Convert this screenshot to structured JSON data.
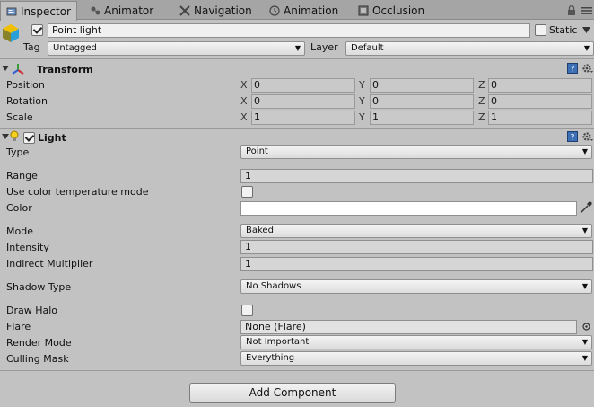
{
  "tabs": [
    {
      "label": "Inspector",
      "icon": "inspector-icon",
      "active": true
    },
    {
      "label": "Animator",
      "icon": "animator-icon",
      "active": false
    },
    {
      "label": "Navigation",
      "icon": "navigation-icon",
      "active": false
    },
    {
      "label": "Animation",
      "icon": "animation-icon",
      "active": false
    },
    {
      "label": "Occlusion",
      "icon": "occlusion-icon",
      "active": false
    }
  ],
  "header": {
    "object_name": "Point light",
    "static_label": "Static",
    "tag_label": "Tag",
    "tag_value": "Untagged",
    "layer_label": "Layer",
    "layer_value": "Default"
  },
  "transform": {
    "title": "Transform",
    "rows": [
      {
        "label": "Position",
        "x": "0",
        "y": "0",
        "z": "0"
      },
      {
        "label": "Rotation",
        "x": "0",
        "y": "0",
        "z": "0"
      },
      {
        "label": "Scale",
        "x": "1",
        "y": "1",
        "z": "1"
      }
    ],
    "axis": {
      "x": "X",
      "y": "Y",
      "z": "Z"
    }
  },
  "light": {
    "title": "Light",
    "type_label": "Type",
    "type_value": "Point",
    "range_label": "Range",
    "range_value": "1",
    "color_temp_label": "Use color temperature mode",
    "color_label": "Color",
    "mode_label": "Mode",
    "mode_value": "Baked",
    "intensity_label": "Intensity",
    "intensity_value": "1",
    "indirect_label": "Indirect Multiplier",
    "indirect_value": "1",
    "shadow_label": "Shadow Type",
    "shadow_value": "No Shadows",
    "halo_label": "Draw Halo",
    "flare_label": "Flare",
    "flare_value": "None (Flare)",
    "render_label": "Render Mode",
    "render_value": "Not Important",
    "culling_label": "Culling Mask",
    "culling_value": "Everything"
  },
  "add_component": "Add Component",
  "dropdown_arrow": "▼",
  "checkmark": "✓",
  "colors": {
    "panel": "#c2c2c2",
    "tabbar": "#a5a5a5",
    "field": "#f0f0f0",
    "color_swatch": "#ffffff"
  }
}
